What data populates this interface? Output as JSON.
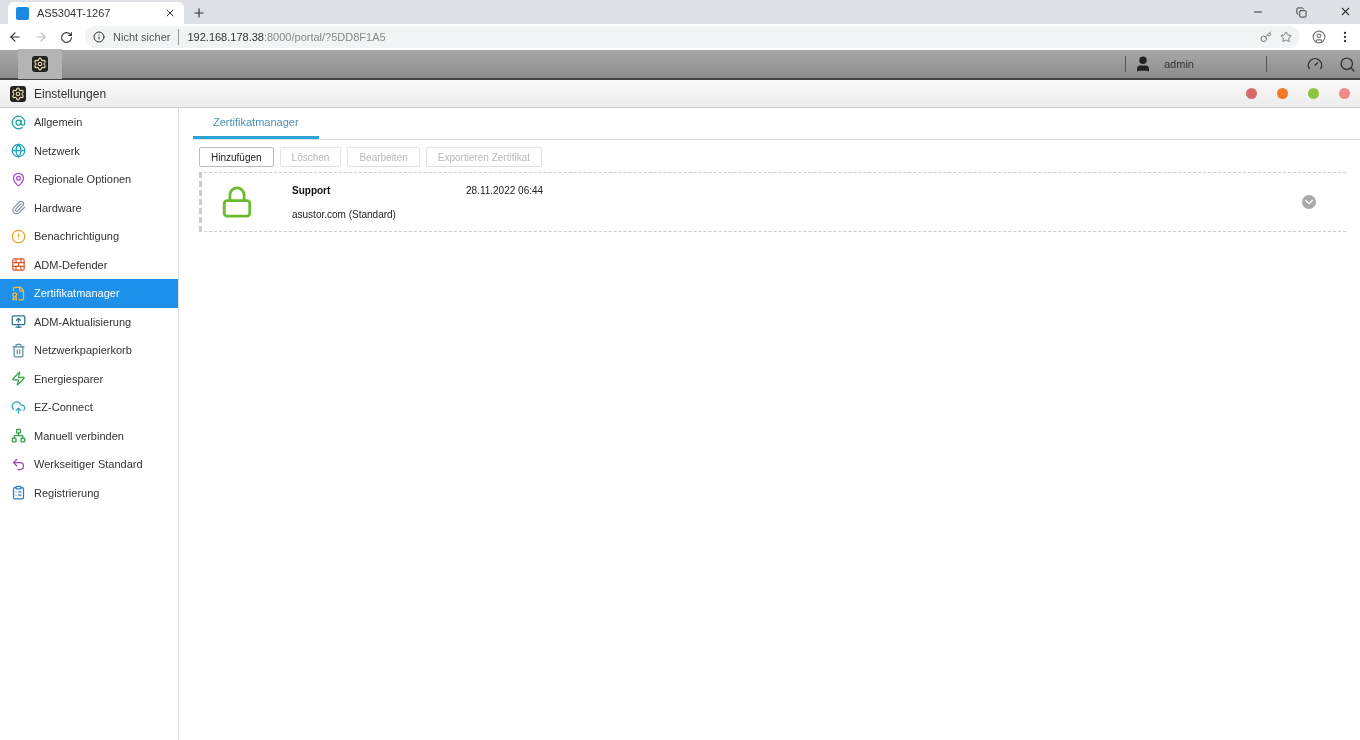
{
  "browser": {
    "tab_title": "AS5304T-1267",
    "security": "Nicht sicher",
    "url_host": "192.168.178.38",
    "url_rest": ":8000/portal/?5DD8F1A5"
  },
  "topbar": {
    "user": "admin"
  },
  "window": {
    "title": "Einstellungen"
  },
  "sidebar": {
    "items": [
      {
        "label": "Allgemein",
        "selected": false
      },
      {
        "label": "Netzwerk",
        "selected": false
      },
      {
        "label": "Regionale Optionen",
        "selected": false
      },
      {
        "label": "Hardware",
        "selected": false
      },
      {
        "label": "Benachrichtigung",
        "selected": false
      },
      {
        "label": "ADM-Defender",
        "selected": false
      },
      {
        "label": "Zertifikatmanager",
        "selected": true
      },
      {
        "label": "ADM-Aktualisierung",
        "selected": false
      },
      {
        "label": "Netzwerkpapierkorb",
        "selected": false
      },
      {
        "label": "Energiesparer",
        "selected": false
      },
      {
        "label": "EZ-Connect",
        "selected": false
      },
      {
        "label": "Manuell verbinden",
        "selected": false
      },
      {
        "label": "Werkseitiger Standard",
        "selected": false
      },
      {
        "label": "Registrierung",
        "selected": false
      }
    ]
  },
  "tabs": [
    {
      "label": "Zertifikatmanager",
      "selected": true
    }
  ],
  "toolbar": [
    {
      "label": "Hinzufügen",
      "disabled": false
    },
    {
      "label": "Löschen",
      "disabled": true
    },
    {
      "label": "Bearbeiten",
      "disabled": true
    },
    {
      "label": "Exportieren Zertifikat",
      "disabled": true
    }
  ],
  "certificates": [
    {
      "issuer": "Support",
      "date": "28.11.2022 06:44",
      "domain": "asustor.com (Standard)"
    }
  ]
}
